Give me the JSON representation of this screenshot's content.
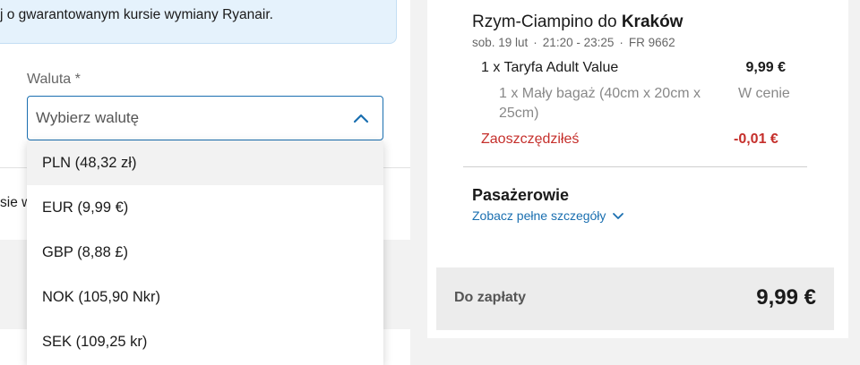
{
  "info_banner": {
    "text": "j o gwarantowanym kursie wymiany Ryanair."
  },
  "cut_text": "sie w",
  "currency_field": {
    "label": "Waluta *",
    "placeholder": "Wybierz walutę",
    "options": [
      "PLN (48,32 zł)",
      "EUR (9,99 €)",
      "GBP (8,88 £)",
      "NOK (105,90 Nkr)",
      "SEK (109,25 kr)"
    ]
  },
  "summary": {
    "route_prefix": "Rzym-Ciampino do ",
    "route_dest": "Kraków",
    "date": "sob. 19 lut",
    "time": "21:20 - 23:25",
    "flight": "FR 9662",
    "fare_label": "1 x Taryfa Adult Value",
    "fare_price": "9,99 €",
    "bag_label": "1 x Mały bagaż (40cm x 20cm x 25cm)",
    "bag_price": "W cenie",
    "saved_label": "Zaoszczędziłeś",
    "saved_price": "-0,01 €",
    "passengers_title": "Pasażerowie",
    "passengers_link": "Zobacz pełne szczegóły",
    "total_label": "Do zapłaty",
    "total_price": "9,99 €"
  },
  "colors": {
    "accent": "#1a6fb0",
    "savings": "#c52f2b",
    "banner_bg": "#e5f2fc"
  },
  "icons": {
    "select_toggle": "chevron-up-icon",
    "details_toggle": "chevron-down-icon"
  }
}
